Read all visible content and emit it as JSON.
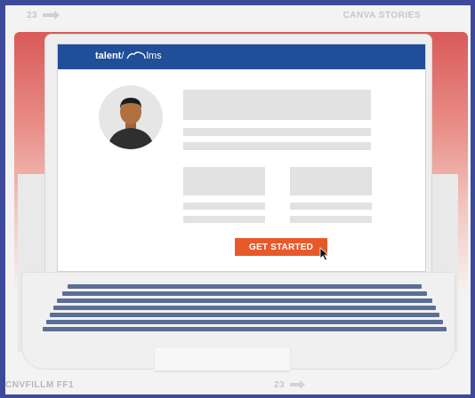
{
  "film_strip": {
    "top_number": "23",
    "top_brand": "CANVA STORIES",
    "bottom_code": "CNVFILLM FF1",
    "bottom_number": "23"
  },
  "screen": {
    "header_color": "#214e98",
    "logo": {
      "part1": "talent",
      "part2": "lms"
    },
    "cta_label": "GET STARTED",
    "cta_color": "#e8592a"
  },
  "icons": {
    "avatar": "person-avatar-icon",
    "cursor": "mouse-pointer-icon",
    "arrow": "arrow-right-icon"
  }
}
